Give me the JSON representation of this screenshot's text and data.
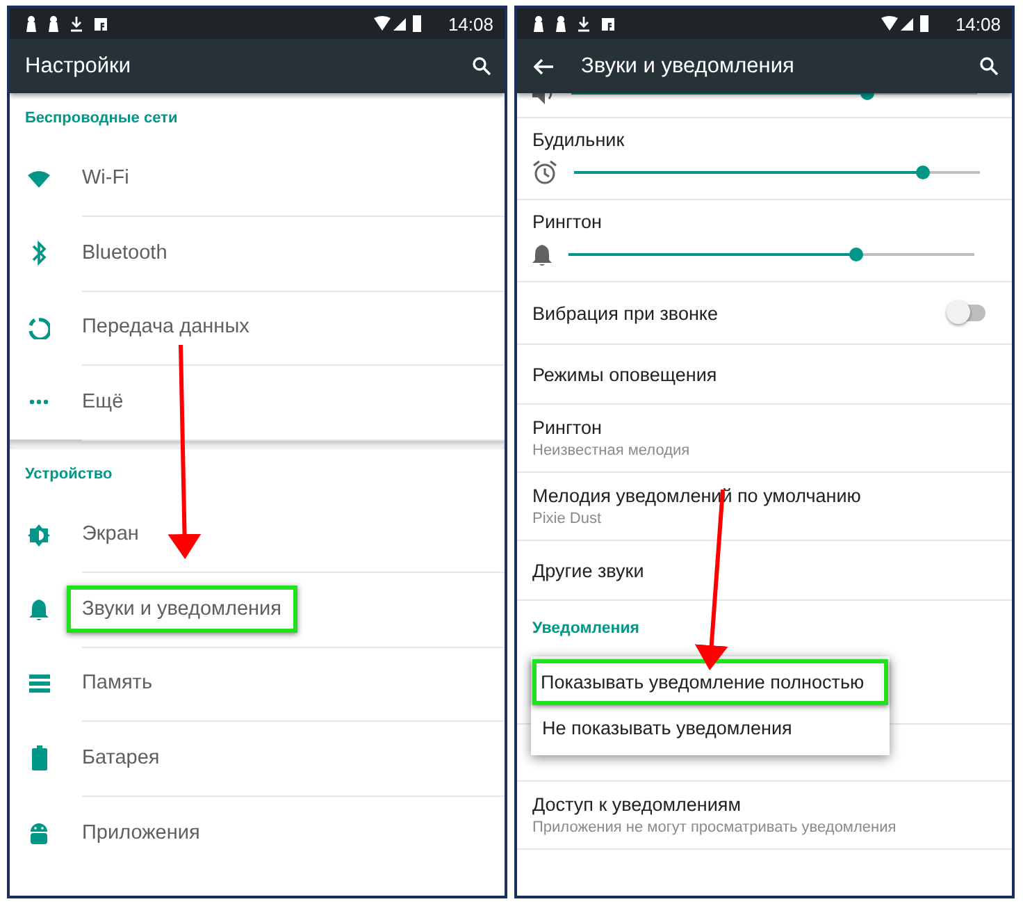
{
  "screens": [
    {
      "status_bar": {
        "time": "14:08"
      },
      "toolbar": {
        "title": "Настройки",
        "back": false
      },
      "sections": [
        {
          "header": "Беспроводные сети",
          "items": [
            {
              "label": "Wi-Fi",
              "highlighted": false
            },
            {
              "label": "Bluetooth",
              "highlighted": false
            },
            {
              "label": "Передача данных",
              "highlighted": false
            },
            {
              "label": "Ещё",
              "highlighted": false
            }
          ]
        },
        {
          "header": "Устройство",
          "items": [
            {
              "label": "Экран",
              "highlighted": false
            },
            {
              "label": "Звуки и уведомления",
              "highlighted": true
            },
            {
              "label": "Память",
              "highlighted": false
            },
            {
              "label": "Батарея",
              "highlighted": false
            },
            {
              "label": "Приложения",
              "highlighted": false
            }
          ]
        }
      ]
    },
    {
      "status_bar": {
        "time": "14:08"
      },
      "toolbar": {
        "title": "Звуки и уведомления",
        "back": true
      },
      "items": [
        {
          "kind": "slider",
          "level": 0.73
        },
        {
          "kind": "slider",
          "label": "Будильник",
          "level": 0.86
        },
        {
          "kind": "slider",
          "label": "Рингтон",
          "level": 0.71
        },
        {
          "kind": "toggle",
          "label": "Вибрация при звонке",
          "on": false
        },
        {
          "kind": "entry",
          "title": "Режимы оповещения"
        },
        {
          "kind": "entry",
          "title": "Рингтон",
          "subtitle": "Неизвестная мелодия"
        },
        {
          "kind": "entry",
          "title": "Мелодия уведомлений по умолчанию",
          "subtitle": "Pixie Dust"
        },
        {
          "kind": "entry",
          "title": "Другие звуки"
        },
        {
          "kind": "header",
          "label": "Уведомления"
        },
        {
          "kind": "menu",
          "options": [
            {
              "label": "Показывать уведомление полностью",
              "highlighted": true
            },
            {
              "label": "Не показывать уведомления",
              "highlighted": false
            }
          ]
        },
        {
          "kind": "entry",
          "title": "Доступ к уведомлениям",
          "subtitle": "Приложения не могут просматривать уведомления"
        }
      ]
    }
  ]
}
